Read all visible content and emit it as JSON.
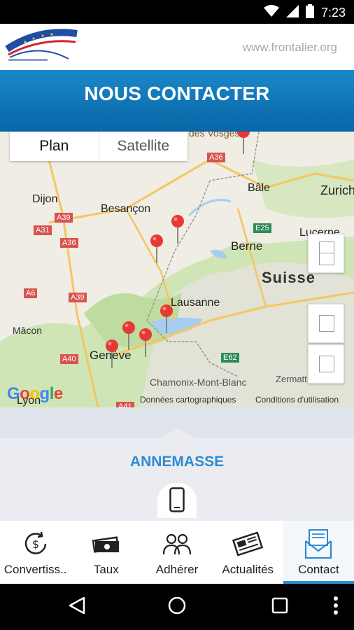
{
  "status_bar": {
    "time": "7:23"
  },
  "header": {
    "url": "www.frontalier.org"
  },
  "title": "NOUS CONTACTER",
  "map": {
    "type_plan": "Plan",
    "type_satellite": "Satellite",
    "labels": {
      "dijon": "Dijon",
      "besancon": "Besançon",
      "bale": "Bâle",
      "zurich": "Zurich",
      "lucerne": "Lucerne",
      "berne": "Berne",
      "suisse": "Suisse",
      "lausanne": "Lausanne",
      "macon": "Mâcon",
      "geneve": "Genève",
      "chamonix": "Chamonix-Mont-Blanc",
      "zermatt": "Zermatt",
      "lyon": "Lyon",
      "vosges": "des Vosges"
    },
    "roads": [
      "A36",
      "A39",
      "A31",
      "A36",
      "A6",
      "A39",
      "A40",
      "E25",
      "E62",
      "A41",
      "A36"
    ],
    "google_letters": [
      "G",
      "o",
      "o",
      "g",
      "l",
      "e"
    ],
    "attribution_data": "Données cartographiques",
    "attribution_terms": "Conditions d'utilisation"
  },
  "location": {
    "city": "ANNEMASSE"
  },
  "tabs": [
    {
      "label": "Convertiss..",
      "icon": "currency-converter-icon"
    },
    {
      "label": "Taux",
      "icon": "banknotes-icon"
    },
    {
      "label": "Adhérer",
      "icon": "people-icon"
    },
    {
      "label": "Actualités",
      "icon": "newspaper-icon"
    },
    {
      "label": "Contact",
      "icon": "contact-letter-icon"
    }
  ],
  "colors": {
    "primary": "#0f73b4",
    "accent": "#2e8bcf",
    "pin": "#e53935"
  }
}
